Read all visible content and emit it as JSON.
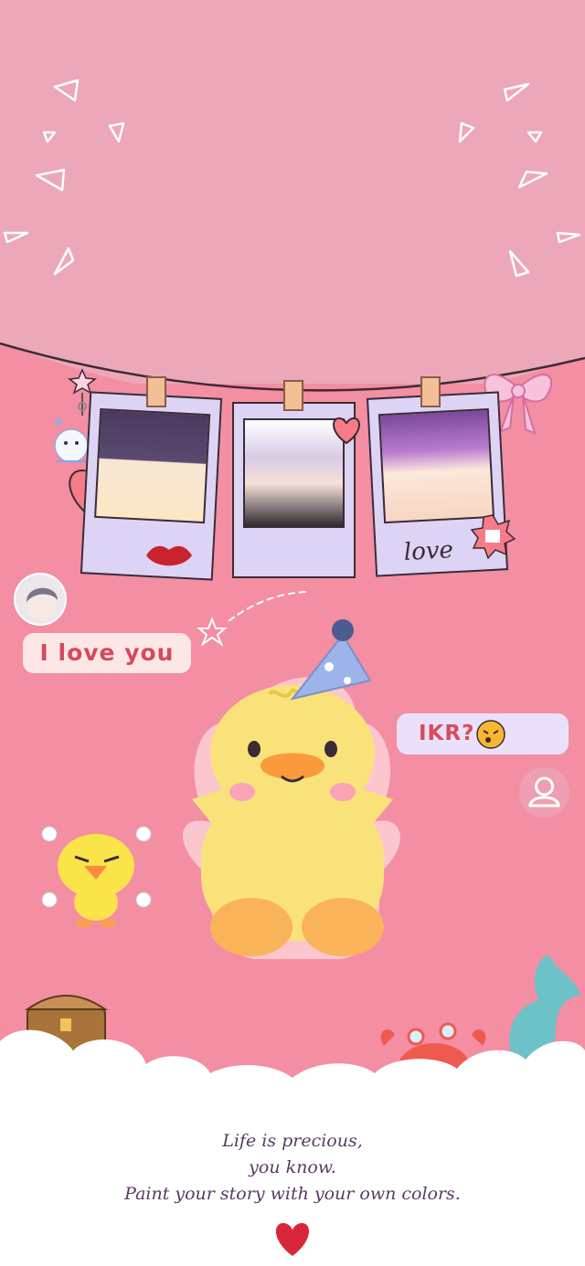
{
  "chat": {
    "left_message": "I love you",
    "right_message": "IKR?"
  },
  "polaroids": [
    {
      "caption": ""
    },
    {
      "caption": ""
    },
    {
      "caption": "love"
    }
  ],
  "footer": {
    "line1": "Life is precious,",
    "line2": "you know.",
    "line3": "Paint your story with your own colors."
  },
  "colors": {
    "sky": "#eca8b8",
    "background": "#f38ea3",
    "bubble_left": "#fde7e6",
    "bubble_right": "#ebe0fb",
    "text_accent": "#d44a5a"
  }
}
